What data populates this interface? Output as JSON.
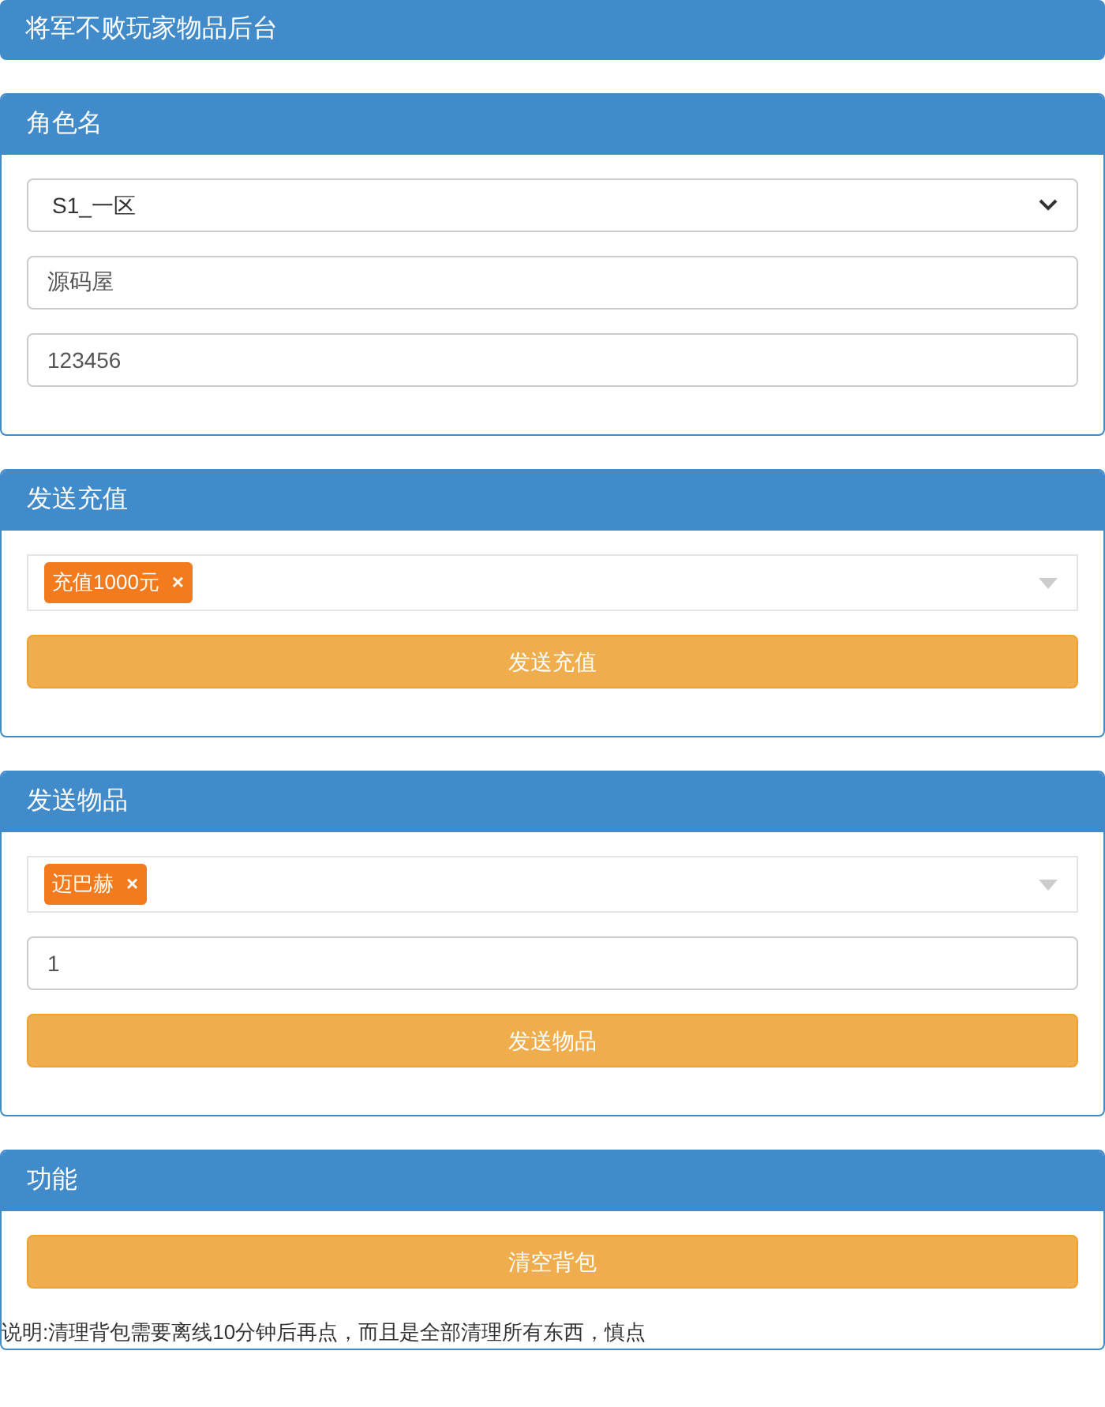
{
  "header": {
    "title": "将军不败玩家物品后台"
  },
  "panels": [
    {
      "title": "角色名",
      "items": [
        {
          "kind": "select",
          "value": "S1_一区"
        },
        {
          "kind": "input",
          "value": "源码屋"
        },
        {
          "kind": "input",
          "value": "123456"
        }
      ]
    },
    {
      "title": "发送充值",
      "items": [
        {
          "kind": "tags",
          "tags": [
            {
              "label": "充值1000元",
              "remove": "×"
            }
          ]
        },
        {
          "kind": "button",
          "label": "发送充值"
        }
      ]
    },
    {
      "title": "发送物品",
      "items": [
        {
          "kind": "tags",
          "tags": [
            {
              "label": "迈巴赫",
              "remove": "×"
            }
          ]
        },
        {
          "kind": "input",
          "value": "1"
        },
        {
          "kind": "button",
          "label": "发送物品"
        }
      ]
    },
    {
      "title": "功能",
      "items": [
        {
          "kind": "button",
          "label": "清空背包"
        },
        {
          "kind": "note",
          "text": "说明:清理背包需要离线10分钟后再点，而且是全部清理所有东西，慎点"
        }
      ]
    }
  ]
}
